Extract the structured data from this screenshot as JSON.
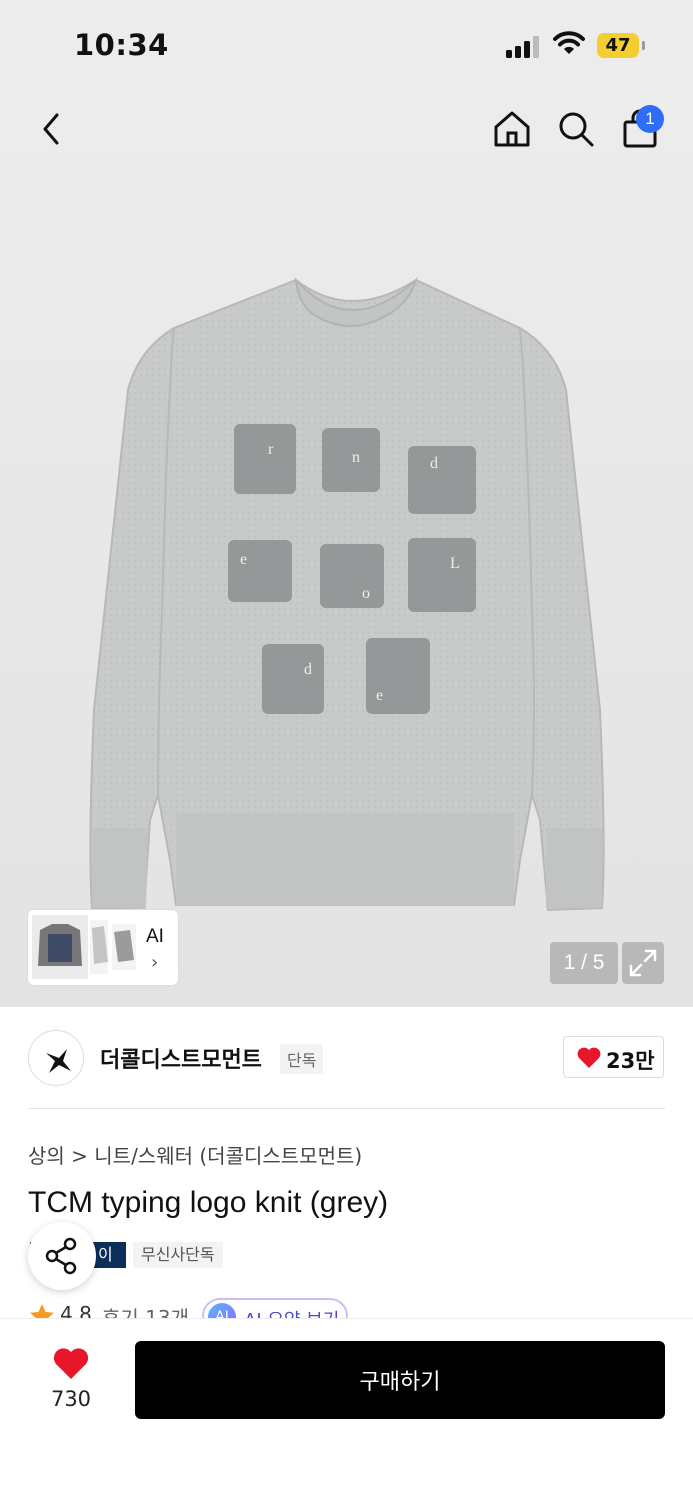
{
  "status_bar": {
    "time": "10:34",
    "battery": "47"
  },
  "header": {
    "cart_count": "1"
  },
  "gallery": {
    "thumb_label": "AI",
    "thumb_chevron": "›",
    "pager": "1 / 5"
  },
  "brand": {
    "name": "더콜디스트모먼트",
    "tag": "단독",
    "likes": "23만"
  },
  "product": {
    "breadcrumb": "상의 > 니트/스웨터 (더콜디스트모먼트)",
    "title": "TCM typing logo knit (grey)",
    "badge_dark": "이",
    "badge_light": "무신사단독",
    "rating": "4.8",
    "reviews": "후기 13개",
    "ai_summary": "AI 요약 보기"
  },
  "bottom_bar": {
    "likes": "730",
    "buy_label": "구매하기"
  },
  "colors": {
    "accent_blue": "#2f6df6",
    "heart_red": "#e8162b",
    "badge_navy": "#0b2f59",
    "buy_black": "#000000",
    "star": "#f59b23"
  },
  "icons": [
    "back-icon",
    "home-icon",
    "search-icon",
    "bag-icon",
    "expand-icon",
    "share-icon",
    "heart-icon",
    "star-icon"
  ]
}
